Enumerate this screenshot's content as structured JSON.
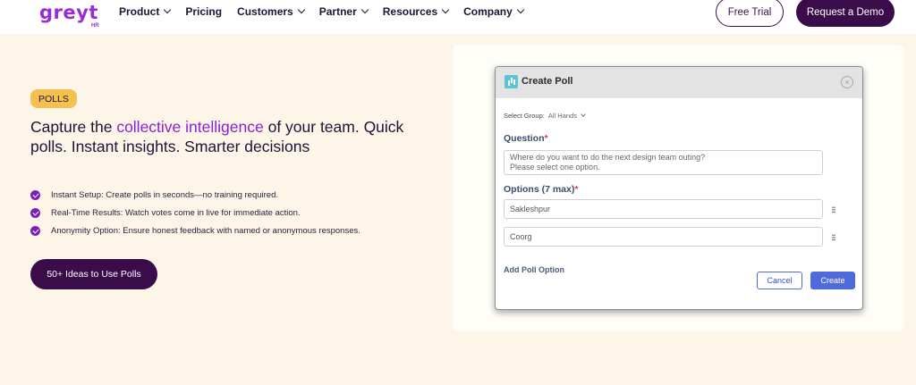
{
  "nav": {
    "logo_text": "greyt",
    "logo_sub": "HR",
    "menu": [
      {
        "label": "Product",
        "has_dropdown": true
      },
      {
        "label": "Pricing",
        "has_dropdown": false
      },
      {
        "label": "Customers",
        "has_dropdown": true
      },
      {
        "label": "Partner",
        "has_dropdown": true
      },
      {
        "label": "Resources",
        "has_dropdown": true
      },
      {
        "label": "Company",
        "has_dropdown": true
      }
    ],
    "free_trial_label": "Free Trial",
    "request_demo_label": "Request a Demo"
  },
  "hero": {
    "badge": "POLLS",
    "headline_pre": "Capture the ",
    "headline_accent": "collective intelligence",
    "headline_post": " of your team. Quick polls. Instant insights. Smarter decisions",
    "features": [
      "Instant Setup: Create polls in seconds—no training required.",
      "Real-Time Results: Watch votes come in live for immediate action.",
      "Anonymity Option: Ensure honest feedback with named or anonymous responses."
    ],
    "cta_label": "50+ Ideas to Use Polls"
  },
  "dialog": {
    "title": "Create Poll",
    "close_glyph": "×",
    "select_group_label": "Select Group:",
    "select_group_value": "All Hands",
    "question_label": "Question",
    "question_value_line1": "Where do you want to do the next design team outing?",
    "question_value_line2": "Please select one option.",
    "options_label": "Options (7 max)",
    "required_mark": "*",
    "options": [
      "Sakleshpur",
      "Coorg"
    ],
    "add_option_label": "Add Poll Option",
    "cancel_label": "Cancel",
    "create_label": "Create"
  },
  "colors": {
    "brand_purple": "#8b21cf",
    "dark_button": "#3a0c4a",
    "badge_yellow": "#f6c04f",
    "primary_blue": "#4f6ad9",
    "page_bg": "#fdf6e8"
  }
}
